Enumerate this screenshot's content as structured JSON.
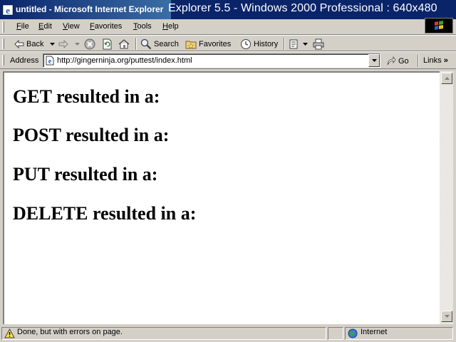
{
  "window": {
    "title": "untitled - Microsoft Internet Explorer",
    "caption_overlay": "Explorer 5.5 - Windows 2000 Professional : 640x480"
  },
  "menu": {
    "items": [
      "File",
      "Edit",
      "View",
      "Favorites",
      "Tools",
      "Help"
    ]
  },
  "toolbar": {
    "back_label": "Back",
    "search_label": "Search",
    "favorites_label": "Favorites",
    "history_label": "History"
  },
  "address": {
    "label": "Address",
    "url": "http://gingerninja.org/puttest/index.html",
    "go_label": "Go",
    "links_label": "Links"
  },
  "content": {
    "headings": [
      "GET resulted in a:",
      "POST resulted in a:",
      "PUT resulted in a:",
      "DELETE resulted in a:"
    ]
  },
  "status": {
    "text": "Done, but with errors on page.",
    "zone": "Internet"
  },
  "colors": {
    "titlebar": "#0a246a",
    "chrome": "#d4d0c8",
    "content_bg": "#ffffff"
  }
}
